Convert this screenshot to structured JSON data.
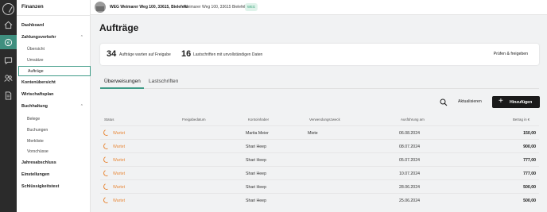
{
  "sidebar": {
    "title": "Finanzen",
    "items": {
      "dashboard": "Dashboard",
      "zahlungsverkehr": "Zahlungsverkehr",
      "uebersicht": "Übersicht",
      "umsaetze": "Umsätze",
      "auftraege": "Aufträge",
      "kontenuebersicht": "Kontenübersicht",
      "wirtschaftsplan": "Wirtschaftsplan",
      "buchhaltung": "Buchhaltung",
      "belege": "Belege",
      "buchungen": "Buchungen",
      "merkliste": "Merkliste",
      "vorschuesse": "Vorschüsse",
      "jahresabschluss": "Jahresabschluss",
      "einstellungen": "Einstellungen",
      "schluesseltest": "Schlüssigkeitstest"
    }
  },
  "topbar": {
    "property_name": "WEG Weimarer Weg 100, 33615, Bielefeld",
    "address": "Weimarer Weg 100, 33615 Bielefeld",
    "badge": "WEG"
  },
  "main": {
    "title": "Aufträge",
    "summary": {
      "count1": "34",
      "text1": "Aufträge warten auf Freigabe",
      "count2": "16",
      "text2": "Lastschriften mit unvollständigen Daten",
      "action": "Prüfen & freigeben"
    },
    "tabs": [
      "Überweisungen",
      "Lastschriften"
    ],
    "toolbar": {
      "refresh": "Aktualisieren",
      "add": "Hinzufügen"
    },
    "table": {
      "headers": [
        "Status",
        "Freigabedatum",
        "Kontoinhaber",
        "Verwendungszweck",
        "Ausführung am",
        "Betrag in €"
      ],
      "rows": [
        {
          "status": "Wartet",
          "freigabe": "",
          "inhaber": "Marita Meier",
          "zweck": "Miete",
          "ausfuehrung": "06.08.2024",
          "betrag": "150,00"
        },
        {
          "status": "Wartet",
          "freigabe": "",
          "inhaber": "Shari Heep",
          "zweck": "",
          "ausfuehrung": "08.07.2024",
          "betrag": "900,00"
        },
        {
          "status": "Wartet",
          "freigabe": "",
          "inhaber": "Shari Heep",
          "zweck": "",
          "ausfuehrung": "05.07.2024",
          "betrag": "777,00"
        },
        {
          "status": "Wartet",
          "freigabe": "",
          "inhaber": "Shari Heep",
          "zweck": "",
          "ausfuehrung": "10.07.2024",
          "betrag": "777,00"
        },
        {
          "status": "Wartet",
          "freigabe": "",
          "inhaber": "Shari Heep",
          "zweck": "",
          "ausfuehrung": "28.06.2024",
          "betrag": "500,00"
        },
        {
          "status": "Wartet",
          "freigabe": "",
          "inhaber": "Shari Heep",
          "zweck": "",
          "ausfuehrung": "25.06.2024",
          "betrag": "500,00"
        }
      ]
    }
  },
  "colors": {
    "accent": "#3f9b87",
    "pending": "#e8893a",
    "rail": "#2b2b2b"
  }
}
